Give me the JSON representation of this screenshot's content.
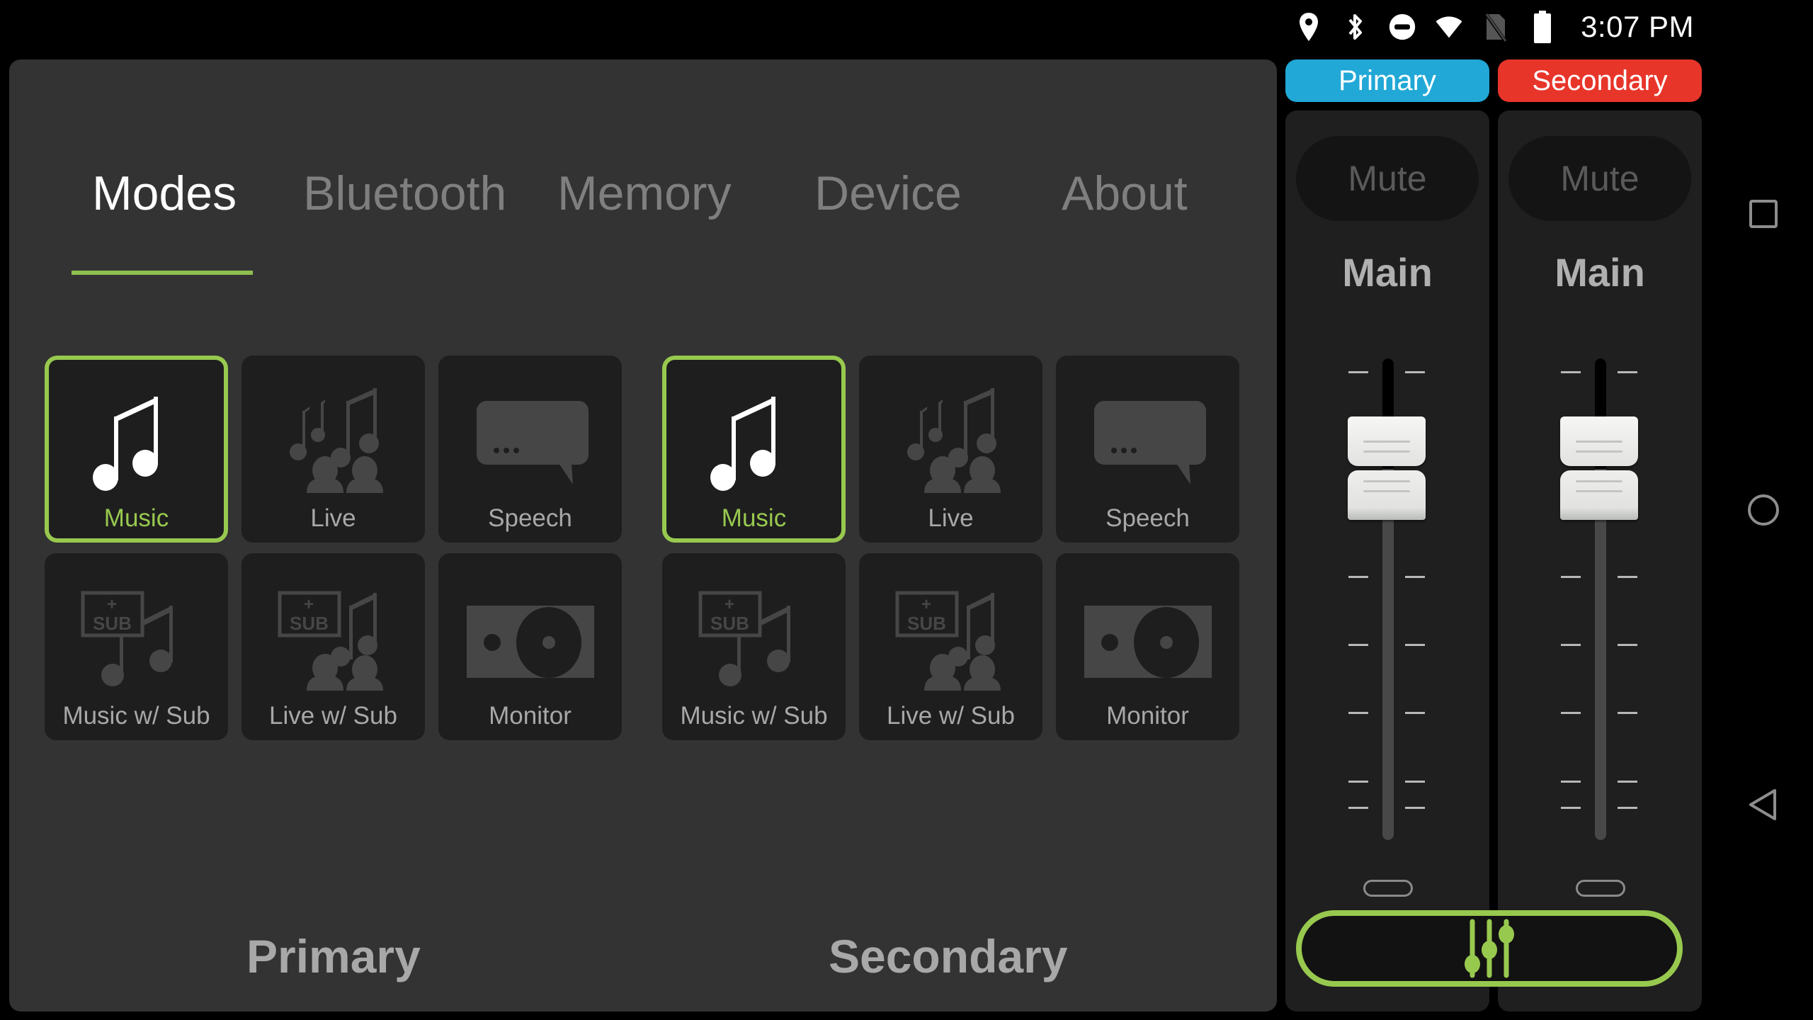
{
  "status_bar": {
    "icons": [
      "location-icon",
      "bluetooth-icon",
      "do-not-disturb-icon",
      "wifi-icon",
      "no-sim-icon",
      "battery-icon"
    ],
    "time": "3:07 PM"
  },
  "tabs": [
    {
      "label": "Modes",
      "active": true
    },
    {
      "label": "Bluetooth",
      "active": false
    },
    {
      "label": "Memory",
      "active": false
    },
    {
      "label": "Device",
      "active": false
    },
    {
      "label": "About",
      "active": false
    }
  ],
  "zones": {
    "primary": {
      "label": "Primary",
      "modes": [
        {
          "label": "Music",
          "icon": "music-note-icon",
          "selected": true
        },
        {
          "label": "Live",
          "icon": "live-audience-icon",
          "selected": false
        },
        {
          "label": "Speech",
          "icon": "speech-bubble-icon",
          "selected": false
        },
        {
          "label": "Music w/ Sub",
          "icon": "music-sub-icon",
          "selected": false
        },
        {
          "label": "Live w/ Sub",
          "icon": "live-sub-icon",
          "selected": false
        },
        {
          "label": "Monitor",
          "icon": "monitor-speaker-icon",
          "selected": false
        }
      ]
    },
    "secondary": {
      "label": "Secondary",
      "modes": [
        {
          "label": "Music",
          "icon": "music-note-icon",
          "selected": true
        },
        {
          "label": "Live",
          "icon": "live-audience-icon",
          "selected": false
        },
        {
          "label": "Speech",
          "icon": "speech-bubble-icon",
          "selected": false
        },
        {
          "label": "Music w/ Sub",
          "icon": "music-sub-icon",
          "selected": false
        },
        {
          "label": "Live w/ Sub",
          "icon": "live-sub-icon",
          "selected": false
        },
        {
          "label": "Monitor",
          "icon": "monitor-speaker-icon",
          "selected": false
        }
      ]
    }
  },
  "mixer": {
    "badges": [
      {
        "label": "Primary",
        "color": "#21a8d6"
      },
      {
        "label": "Secondary",
        "color": "#e8352a"
      }
    ],
    "channels": [
      {
        "mute_label": "Mute",
        "name": "Main",
        "level": 0.77
      },
      {
        "mute_label": "Mute",
        "name": "Main",
        "level": 0.77
      }
    ],
    "mixer_button_icon": "mixer-sliders-icon"
  },
  "colors": {
    "accent": "#98c94f",
    "primary_zone": "#21a8d6",
    "secondary_zone": "#e8352a",
    "panel_bg": "#333333",
    "tile_bg": "#1e1e1e"
  },
  "nav_bar": [
    "recents-icon",
    "home-icon",
    "back-icon"
  ]
}
